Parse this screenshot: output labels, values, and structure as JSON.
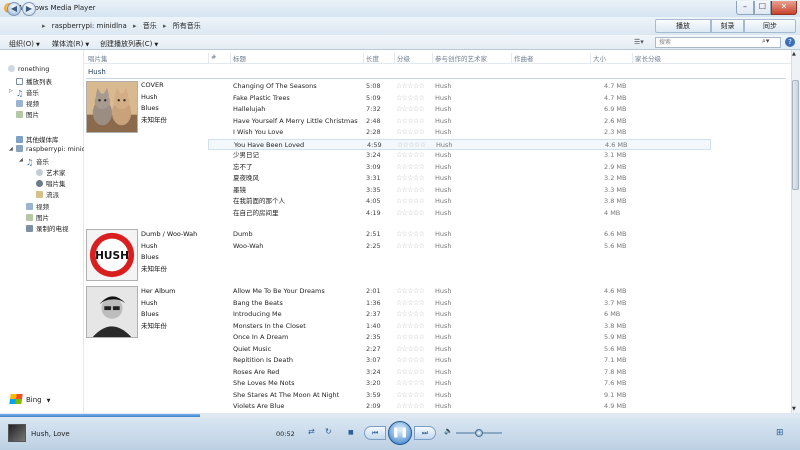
{
  "window": {
    "title": "Windows Media Player",
    "min": "–",
    "max": "☐",
    "close": "✕"
  },
  "breadcrumb": [
    "raspberrypi: minidlna",
    "音乐",
    "所有音乐"
  ],
  "tabs": {
    "play": "播放",
    "burn": "刻录",
    "sync": "同步"
  },
  "toolbar": {
    "organize": "组织(O)",
    "stream": "媒体流(R)",
    "create_playlist": "创建播放列表(C)",
    "search_placeholder": "搜索",
    "view_icon": "view-options-icon",
    "help": "?"
  },
  "sidebar": {
    "top": [
      {
        "label": "ronething",
        "icon": "user-icon"
      },
      {
        "label": "播放列表",
        "icon": "playlist-icon"
      },
      {
        "label": "音乐",
        "icon": "music-icon"
      },
      {
        "label": "视频",
        "icon": "video-icon"
      },
      {
        "label": "图片",
        "icon": "picture-icon"
      }
    ],
    "other_libs": "其他媒体库",
    "library": "raspberrypi: minid",
    "lib_items": [
      {
        "label": "音乐",
        "icon": "music-icon"
      },
      {
        "label": "艺术家",
        "icon": "artist-icon"
      },
      {
        "label": "唱片集",
        "icon": "album-icon"
      },
      {
        "label": "流派",
        "icon": "genre-icon"
      },
      {
        "label": "视频",
        "icon": "video-icon"
      },
      {
        "label": "图片",
        "icon": "picture-icon"
      },
      {
        "label": "录制的电视",
        "icon": "tv-icon"
      }
    ],
    "bing": "Bing"
  },
  "columns": [
    "唱片集",
    "#",
    "标题",
    "长度",
    "分级",
    "参与创作的艺术家",
    "作曲者",
    "大小",
    "家长分级"
  ],
  "group": "Hush",
  "albums": [
    {
      "title": "COVER",
      "artist": "Hush",
      "genre": "Blues",
      "year": "未知年份",
      "tracks": [
        {
          "title": "Changing Of The Seasons",
          "length": "5:08",
          "artist": "Hush",
          "size": "4.7 MB"
        },
        {
          "title": "Fake Plastic Trees",
          "length": "5:09",
          "artist": "Hush",
          "size": "4.7 MB"
        },
        {
          "title": "Hallelujah",
          "length": "7:32",
          "artist": "Hush",
          "size": "6.9 MB"
        },
        {
          "title": "Have Yourself A Merry Little Christmas",
          "length": "2:48",
          "artist": "Hush",
          "size": "2.6 MB"
        },
        {
          "title": "I Wish You Love",
          "length": "2:28",
          "artist": "Hush",
          "size": "2.3 MB"
        },
        {
          "title": "You Have Been Loved",
          "length": "4:59",
          "artist": "Hush",
          "size": "4.6 MB"
        },
        {
          "title": "少男日记",
          "length": "3:24",
          "artist": "Hush",
          "size": "3.1 MB"
        },
        {
          "title": "忘不了",
          "length": "3:09",
          "artist": "Hush",
          "size": "2.9 MB"
        },
        {
          "title": "夏夜晚风",
          "length": "3:31",
          "artist": "Hush",
          "size": "3.2 MB"
        },
        {
          "title": "墨镜",
          "length": "3:35",
          "artist": "Hush",
          "size": "3.3 MB"
        },
        {
          "title": "在我前面的那个人",
          "length": "4:05",
          "artist": "Hush",
          "size": "3.8 MB"
        },
        {
          "title": "在自己的房间里",
          "length": "4:19",
          "artist": "Hush",
          "size": "4 MB"
        }
      ]
    },
    {
      "title": "Dumb / Woo-Wah",
      "artist": "Hush",
      "genre": "Blues",
      "year": "未知年份",
      "tracks": [
        {
          "title": "Dumb",
          "length": "2:51",
          "artist": "Hush",
          "size": "6.6 MB"
        },
        {
          "title": "Woo-Wah",
          "length": "2:25",
          "artist": "Hush",
          "size": "5.6 MB"
        }
      ]
    },
    {
      "title": "Her Album",
      "artist": "Hush",
      "genre": "Blues",
      "year": "未知年份",
      "tracks": [
        {
          "title": "Allow Me To Be Your Dreams",
          "length": "2:01",
          "artist": "Hush",
          "size": "4.6 MB"
        },
        {
          "title": "Bang the Beats",
          "length": "1:36",
          "artist": "Hush",
          "size": "3.7 MB"
        },
        {
          "title": "Introducing Me",
          "length": "2:37",
          "artist": "Hush",
          "size": "6 MB"
        },
        {
          "title": "Monsters In the Closet",
          "length": "1:40",
          "artist": "Hush",
          "size": "3.8 MB"
        },
        {
          "title": "Once In A Dream",
          "length": "2:35",
          "artist": "Hush",
          "size": "5.9 MB"
        },
        {
          "title": "Quiet Music",
          "length": "2:27",
          "artist": "Hush",
          "size": "5.6 MB"
        },
        {
          "title": "Repitition Is Death",
          "length": "3:07",
          "artist": "Hush",
          "size": "7.1 MB"
        },
        {
          "title": "Roses Are Red",
          "length": "3:24",
          "artist": "Hush",
          "size": "7.8 MB"
        },
        {
          "title": "She Loves Me Nots",
          "length": "3:20",
          "artist": "Hush",
          "size": "7.6 MB"
        },
        {
          "title": "She Stares At The Moon At Night",
          "length": "3:59",
          "artist": "Hush",
          "size": "9.1 MB"
        },
        {
          "title": "Violets Are Blue",
          "length": "2:09",
          "artist": "Hush",
          "size": "4.9 MB"
        }
      ]
    }
  ],
  "selected_track": "You Have Been Loved",
  "rating_stars": "☆☆☆☆☆",
  "player": {
    "now_playing": "Hush, Love",
    "time": "00:52",
    "progress": 0.25,
    "volume": 0.5,
    "shuffle": "⇄",
    "repeat": "↻",
    "stop": "■",
    "prev": "⏮",
    "play_pause": "❚❚",
    "next": "⏭",
    "mute": "🔈",
    "switch": "⊞"
  },
  "colors": {
    "accent": "#3a80cc",
    "selection": "#f3f8fd"
  }
}
